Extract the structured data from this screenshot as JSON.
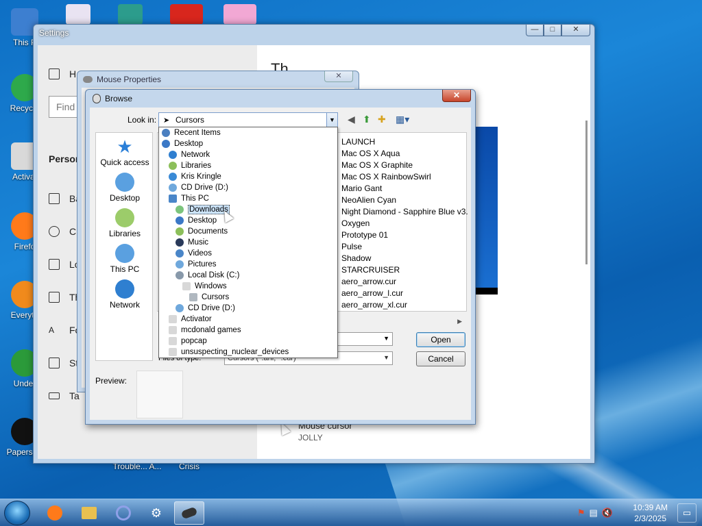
{
  "desktop": {
    "icons": [
      {
        "label": "This P",
        "color": "#3d7fd0"
      },
      {
        "label": "Recycle",
        "color": "#2ea94b"
      },
      {
        "label": "Activat",
        "color": "#d9d9d9"
      },
      {
        "label": "Firefo",
        "color": "#ff7a1a"
      },
      {
        "label": "Everyth",
        "color": "#f08a1c"
      },
      {
        "label": "Under",
        "color": "#2b9a3a"
      },
      {
        "label": "Papers, P",
        "color": "#111111"
      }
    ],
    "bottom_labels": [
      "Trouble... A...",
      "Crisis"
    ]
  },
  "settings": {
    "title": "Settings",
    "buttons": {
      "minimize": "—",
      "maximize": "□",
      "close": "✕"
    },
    "nav": {
      "home": "H",
      "search_placeholder": "Find",
      "section": "Person",
      "items": [
        "Ba",
        "C",
        "Lo",
        "Th",
        "Fo",
        "St",
        "Ta"
      ]
    },
    "right_title": "Th",
    "cursor_label": "Mouse cursor",
    "cursor_value": "JOLLY"
  },
  "mouse_properties": {
    "title": "Mouse Properties",
    "close": "✕"
  },
  "browse": {
    "title": "Browse",
    "close": "✕",
    "look_in_label": "Look in:",
    "look_in_value": "Cursors",
    "places": [
      "Quick access",
      "Desktop",
      "Libraries",
      "This PC",
      "Network"
    ],
    "files": [
      "LAUNCH",
      "Mac OS X Aqua",
      "Mac OS X Graphite",
      "Mac OS X RainbowSwirl",
      "Mario Gant",
      "NeoAlien Cyan",
      "Night Diamond - Sapphire Blue v3.",
      "Oxygen",
      "Prototype 01",
      "Pulse",
      "Shadow",
      "STARCRUISER",
      "aero_arrow.cur",
      "aero_arrow_l.cur",
      "aero_arrow_xl.cur"
    ],
    "file_type_label": "Files of type:",
    "file_type_value": "Cursors (*.ani; *.cur)",
    "open_label": "Open",
    "cancel_label": "Cancel",
    "preview_label": "Preview:",
    "dropdown": [
      {
        "label": "Recent Items",
        "indent": 0,
        "color": "#4a7fc0"
      },
      {
        "label": "Desktop",
        "indent": 0,
        "color": "#3b78c6"
      },
      {
        "label": "Network",
        "indent": 1,
        "color": "#2f7fd0"
      },
      {
        "label": "Libraries",
        "indent": 1,
        "color": "#8cbf5a"
      },
      {
        "label": "Kris Kringle",
        "indent": 1,
        "color": "#3a8ad6"
      },
      {
        "label": "CD Drive (D:)",
        "indent": 1,
        "color": "#6fa8dc"
      },
      {
        "label": "This PC",
        "indent": 1,
        "color": "#4a86c8"
      },
      {
        "label": "Downloads",
        "indent": 2,
        "color": "#7cc47c",
        "selected": true
      },
      {
        "label": "Desktop",
        "indent": 2,
        "color": "#3b78c6"
      },
      {
        "label": "Documents",
        "indent": 2,
        "color": "#8cbf5a"
      },
      {
        "label": "Music",
        "indent": 2,
        "color": "#2a3a5a"
      },
      {
        "label": "Videos",
        "indent": 2,
        "color": "#4a86c8"
      },
      {
        "label": "Pictures",
        "indent": 2,
        "color": "#6fa8dc"
      },
      {
        "label": "Local Disk (C:)",
        "indent": 2,
        "color": "#8899aa"
      },
      {
        "label": "Windows",
        "indent": 3,
        "color": "#d8d8d8"
      },
      {
        "label": "Cursors",
        "indent": 4,
        "color": "#b0b8c0"
      },
      {
        "label": "CD Drive (D:)",
        "indent": 2,
        "color": "#6fa8dc"
      },
      {
        "label": "Activator",
        "indent": 1,
        "color": "#d8d8d8"
      },
      {
        "label": "mcdonald games",
        "indent": 1,
        "color": "#d8d8d8"
      },
      {
        "label": "popcap",
        "indent": 1,
        "color": "#d8d8d8"
      },
      {
        "label": "unsuspecting_nuclear_devices",
        "indent": 1,
        "color": "#d8d8d8"
      }
    ]
  },
  "taskbar": {
    "apps": [
      "firefox",
      "explorer",
      "app-circle",
      "settings",
      "mouse"
    ],
    "time": "10:39 AM",
    "date": "2/3/2025"
  }
}
